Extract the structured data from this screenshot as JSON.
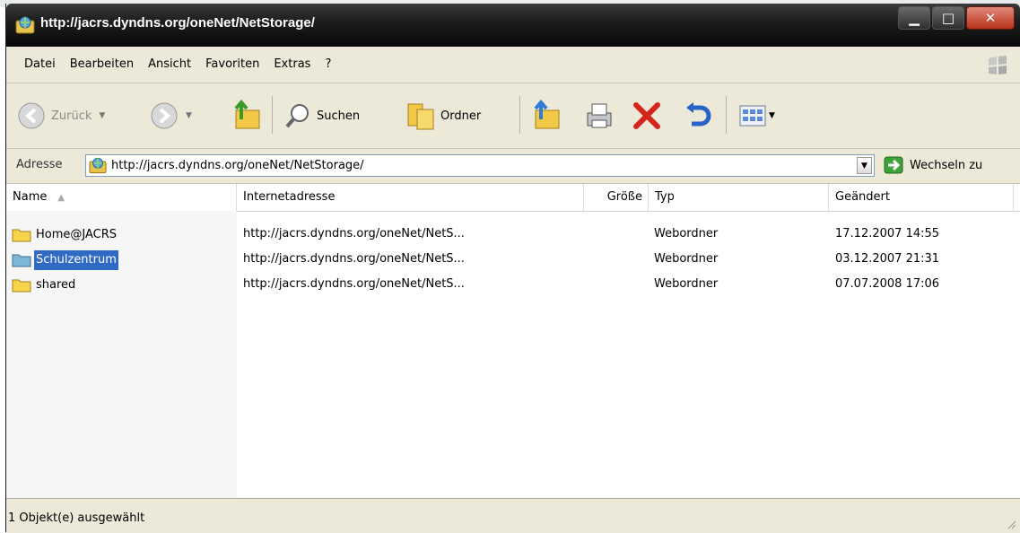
{
  "window": {
    "title": "http://jacrs.dyndns.org/oneNet/NetStorage/"
  },
  "menu": [
    "Datei",
    "Bearbeiten",
    "Ansicht",
    "Favoriten",
    "Extras",
    "?"
  ],
  "toolbar": {
    "back_label": "Zurück",
    "search_label": "Suchen",
    "folders_label": "Ordner"
  },
  "address": {
    "label": "Adresse",
    "value": "http://jacrs.dyndns.org/oneNet/NetStorage/",
    "go_label": "Wechseln zu"
  },
  "columns": {
    "name": "Name",
    "url": "Internetadresse",
    "size": "Größe",
    "type": "Typ",
    "modified": "Geändert"
  },
  "rows": [
    {
      "name": "Home@JACRS",
      "url": "http://jacrs.dyndns.org/oneNet/NetS...",
      "size": "",
      "type": "Webordner",
      "modified": "17.12.2007 14:55",
      "selected": false
    },
    {
      "name": "Schulzentrum",
      "url": "http://jacrs.dyndns.org/oneNet/NetS...",
      "size": "",
      "type": "Webordner",
      "modified": "03.12.2007 21:31",
      "selected": true
    },
    {
      "name": "shared",
      "url": "http://jacrs.dyndns.org/oneNet/NetS...",
      "size": "",
      "type": "Webordner",
      "modified": "07.07.2008 17:06",
      "selected": false
    }
  ],
  "status": {
    "text": "1 Objekt(e) ausgewählt"
  },
  "colors": {
    "selection": "#316ac5",
    "folder": "#f7d54a",
    "folder_selected": "#7eb7d6",
    "titlebar": "#1e1e1e"
  },
  "icons": [
    "web-folder-icon",
    "back-arrow-icon",
    "forward-arrow-icon",
    "up-folder-icon",
    "search-icon",
    "folders-icon",
    "move-to-icon",
    "print-icon",
    "delete-icon",
    "undo-icon",
    "views-icon",
    "go-arrow-icon",
    "windows-logo-icon"
  ]
}
